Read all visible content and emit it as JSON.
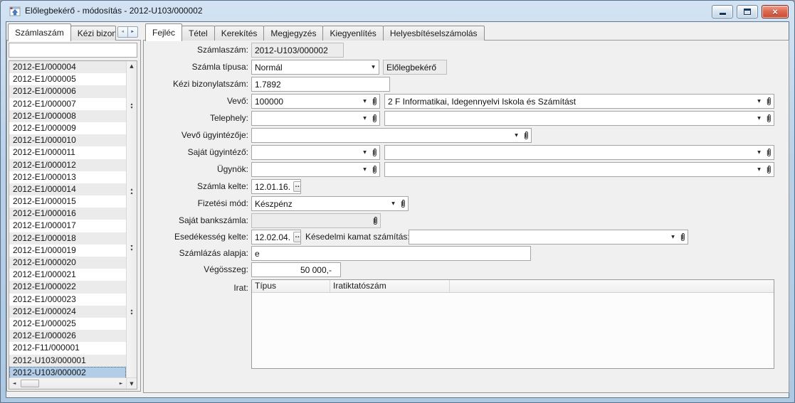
{
  "icons": {
    "dropdown": "▼",
    "up": "▲",
    "down": "▼",
    "up_small": "▴",
    "down_small": "▾",
    "left": "◄",
    "right": "►",
    "ellipsis": "...",
    "close": "×"
  },
  "window": {
    "title": "Előlegbekérő - módosítás - 2012-U103/000002"
  },
  "left_panel": {
    "tabs": [
      {
        "label": "Számlaszám"
      },
      {
        "label": "Kézi bizonyl"
      }
    ],
    "filter_value": "",
    "items": [
      "2012-E1/000004",
      "2012-E1/000005",
      "2012-E1/000006",
      "2012-E1/000007",
      "2012-E1/000008",
      "2012-E1/000009",
      "2012-E1/000010",
      "2012-E1/000011",
      "2012-E1/000012",
      "2012-E1/000013",
      "2012-E1/000014",
      "2012-E1/000015",
      "2012-E1/000016",
      "2012-E1/000017",
      "2012-E1/000018",
      "2012-E1/000019",
      "2012-E1/000020",
      "2012-E1/000021",
      "2012-E1/000022",
      "2012-E1/000023",
      "2012-E1/000024",
      "2012-E1/000025",
      "2012-E1/000026",
      "2012-F11/000001",
      "2012-U103/000001",
      "2012-U103/000002"
    ],
    "selected_item": "2012-U103/000002"
  },
  "main": {
    "tabs": [
      {
        "label": "Fejléc"
      },
      {
        "label": "Tétel"
      },
      {
        "label": "Kerekítés"
      },
      {
        "label": "Megjegyzés"
      },
      {
        "label": "Kiegyenlítés"
      },
      {
        "label": "Helyesbítéselszámolás"
      }
    ],
    "fields": {
      "szamlaszam": {
        "label": "Számlaszám:",
        "value": "2012-U103/000002"
      },
      "szamla_tipusa": {
        "label": "Számla típusa:",
        "value": "Normál",
        "badge": "Előlegbekérő"
      },
      "kezi_bizonylatszam": {
        "label": "Kézi bizonylatszám:",
        "value": "1.7892"
      },
      "vevo": {
        "label": "Vevő:",
        "code": "100000",
        "name": "2 F Informatikai, Idegennyelvi Iskola és Számítást"
      },
      "telephely": {
        "label": "Telephely:",
        "code": "",
        "name": ""
      },
      "vevo_ugyintezoje": {
        "label": "Vevő ügyintézője:",
        "value": ""
      },
      "sajat_ugyintezo": {
        "label": "Saját ügyintéző:",
        "code": "",
        "name": ""
      },
      "ugynok": {
        "label": "Ügynök:",
        "code": "",
        "name": ""
      },
      "szamla_kelte": {
        "label": "Számla kelte:",
        "value": "12.01.16."
      },
      "fizetesi_mod": {
        "label": "Fizetési mód:",
        "value": "Készpénz"
      },
      "sajat_bankszamla": {
        "label": "Saját bankszámla:",
        "value": ""
      },
      "esedekesseg_kelte": {
        "label": "Esedékesség kelte:",
        "value": "12.02.04."
      },
      "kesedelmi_kamat": {
        "label": "Késedelmi kamat számítás:",
        "value": ""
      },
      "szamlazas_alapja": {
        "label": "Számlázás alapja:",
        "value": "e"
      },
      "vegosszeg": {
        "label": "Végösszeg:",
        "value": "50 000,-"
      },
      "irat": {
        "label": "Irat:",
        "columns": [
          "Típus",
          "Iratiktatószám"
        ]
      }
    }
  }
}
